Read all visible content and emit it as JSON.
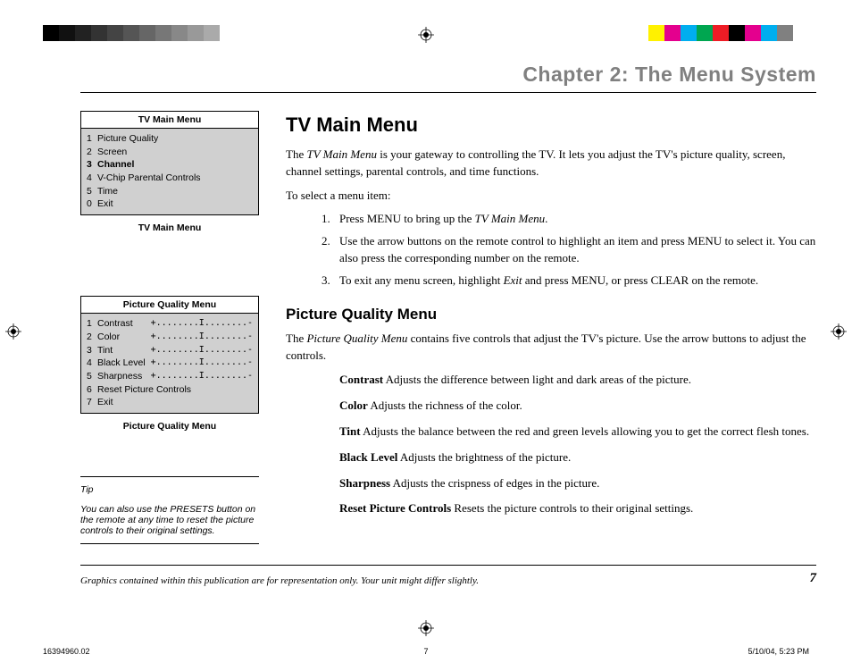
{
  "colorBarLeft": [
    "#000",
    "#111",
    "#222",
    "#333",
    "#444",
    "#555",
    "#666",
    "#777",
    "#888",
    "#999",
    "#aaa"
  ],
  "colorBarRight": [
    "#fff100",
    "#e4008e",
    "#00aeef",
    "#00a650",
    "#ee1c25",
    "#000",
    "#e4008e",
    "#00aeef",
    "#808080",
    "#fff"
  ],
  "chapterTitle": "Chapter 2: The Menu System",
  "sidebar": {
    "menu1": {
      "title": "TV Main Menu",
      "items": [
        {
          "n": "1",
          "label": "Picture Quality",
          "sel": false
        },
        {
          "n": "2",
          "label": "Screen",
          "sel": false
        },
        {
          "n": "3",
          "label": "Channel",
          "sel": true
        },
        {
          "n": "4",
          "label": "V-Chip Parental Controls",
          "sel": false
        },
        {
          "n": "5",
          "label": "Time",
          "sel": false
        },
        {
          "n": "0",
          "label": "Exit",
          "sel": false
        }
      ],
      "caption": "TV Main Menu"
    },
    "menu2": {
      "title": "Picture Quality Menu",
      "items": [
        {
          "n": "1",
          "label": "Contrast",
          "val": "+........I........-"
        },
        {
          "n": "2",
          "label": "Color",
          "val": "+........I........-"
        },
        {
          "n": "3",
          "label": "Tint",
          "val": "+........I........-"
        },
        {
          "n": "4",
          "label": "Black Level",
          "val": "+........I........-"
        },
        {
          "n": "5",
          "label": "Sharpness",
          "val": "+........I........-"
        },
        {
          "n": "6",
          "label": "Reset Picture Controls",
          "val": ""
        },
        {
          "n": "7",
          "label": "Exit",
          "val": ""
        }
      ],
      "caption": "Picture Quality Menu"
    },
    "tip": {
      "label": "Tip",
      "text": "You can also use the PRESETS button on the remote at any time to reset the picture controls to their original settings."
    }
  },
  "main": {
    "h1": "TV Main Menu",
    "intro1a": "The ",
    "intro1b": "TV Main Menu",
    "intro1c": " is your gateway to controlling the TV.  It lets you adjust the TV's picture quality, screen, channel settings, parental controls, and time functions.",
    "selectLine": "To select a menu item:",
    "steps": [
      {
        "n": "1.",
        "a": "Press MENU to bring up the ",
        "i": "TV Main Menu",
        "b": "."
      },
      {
        "n": "2.",
        "a": "Use the arrow buttons on the remote control to highlight an item and press MENU to select it. You can also press the corresponding number on the remote.",
        "i": "",
        "b": ""
      },
      {
        "n": "3.",
        "a": "To exit any menu screen, highlight ",
        "i": "Exit",
        "b": " and press MENU, or press CLEAR on the remote."
      }
    ],
    "h2": "Picture Quality Menu",
    "pq1a": "The ",
    "pq1b": "Picture Quality Menu",
    "pq1c": " contains five controls that adjust the TV's picture. Use the arrow buttons to adjust the controls.",
    "defs": [
      {
        "term": "Contrast",
        "desc": "  Adjusts the difference between light and dark areas of the picture."
      },
      {
        "term": "Color",
        "desc": "  Adjusts the richness of the color."
      },
      {
        "term": "Tint",
        "desc": "  Adjusts the balance between the red and green levels allowing you to get the correct flesh tones."
      },
      {
        "term": "Black Level",
        "desc": "  Adjusts the brightness of the picture."
      },
      {
        "term": "Sharpness",
        "desc": "  Adjusts the crispness of edges in the picture."
      },
      {
        "term": "Reset Picture Controls",
        "desc": "  Resets the picture controls to their original settings."
      }
    ]
  },
  "footer": {
    "disclaimer": "Graphics contained within this publication are for representation only. Your unit might differ slightly.",
    "pageNum": "7"
  },
  "printFooter": {
    "docId": "16394960.02",
    "page": "7",
    "datetime": "5/10/04, 5:23 PM"
  }
}
